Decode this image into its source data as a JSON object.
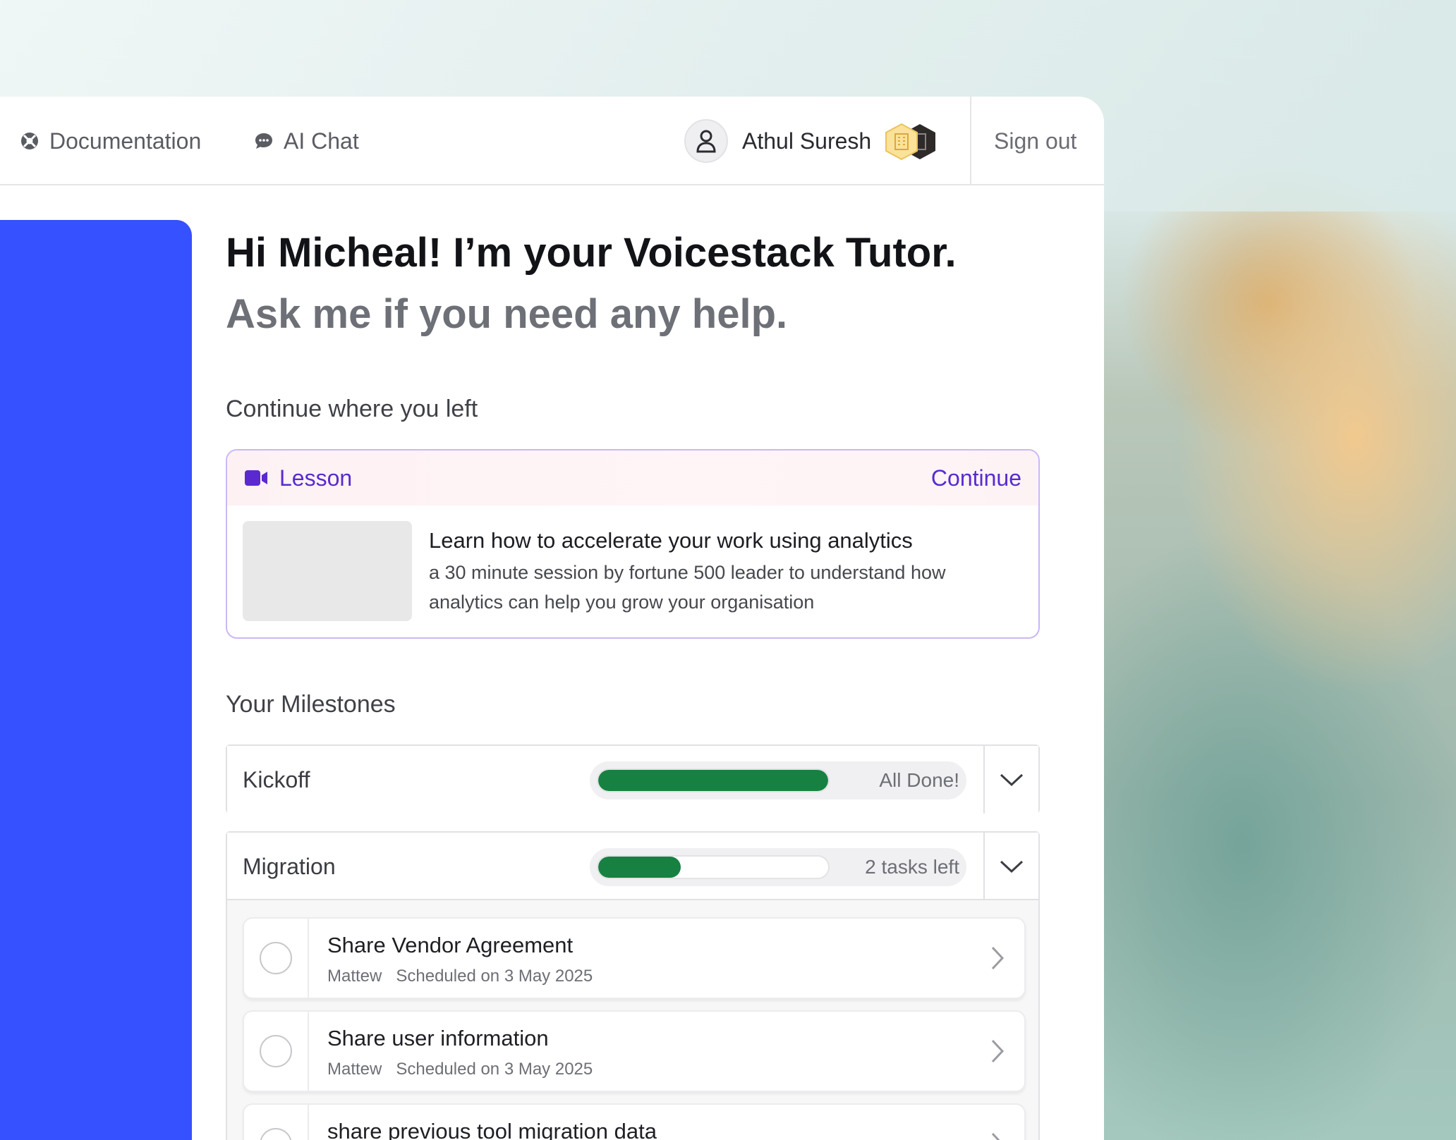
{
  "nav": {
    "documentation_label": "Documentation",
    "ai_chat_label": "AI Chat",
    "user_name": "Athul Suresh",
    "sign_out_label": "Sign out"
  },
  "hero": {
    "greeting": "Hi Micheal! I’m your Voicestack Tutor.",
    "subtitle": "Ask me if you need any help."
  },
  "continue_section": {
    "title": "Continue where you left",
    "card": {
      "tag": "Lesson",
      "action": "Continue",
      "title": "Learn how to accelerate your work using analytics",
      "description": "a 30 minute session by fortune 500 leader to understand how analytics can help you grow your organisation"
    }
  },
  "milestones": {
    "title": "Your Milestones",
    "items": [
      {
        "name": "Kickoff",
        "status": "All Done!",
        "progress": 1.0
      },
      {
        "name": "Migration",
        "status": "2 tasks left",
        "progress": 0.36
      }
    ],
    "tasks": [
      {
        "title": "Share Vendor Agreement",
        "assignee": "Mattew",
        "scheduled": "Scheduled on 3 May 2025"
      },
      {
        "title": "Share user information",
        "assignee": "Mattew",
        "scheduled": "Scheduled on 3 May 2025"
      },
      {
        "title": "share previous tool migration data",
        "assignee": "",
        "scheduled": ""
      }
    ]
  },
  "colors": {
    "accent_blue": "#3651ff",
    "lesson_purple": "#5a2ad0",
    "progress_green": "#178141"
  },
  "icons": {
    "documentation": "lifebuoy-icon",
    "ai_chat": "chat-bubble-icon",
    "user": "user-icon",
    "badges": [
      "building-badge-icon",
      "building-badge-icon"
    ],
    "lesson": "video-camera-icon",
    "expand": "chevron-down-icon",
    "task_open": "chevron-right-icon"
  }
}
